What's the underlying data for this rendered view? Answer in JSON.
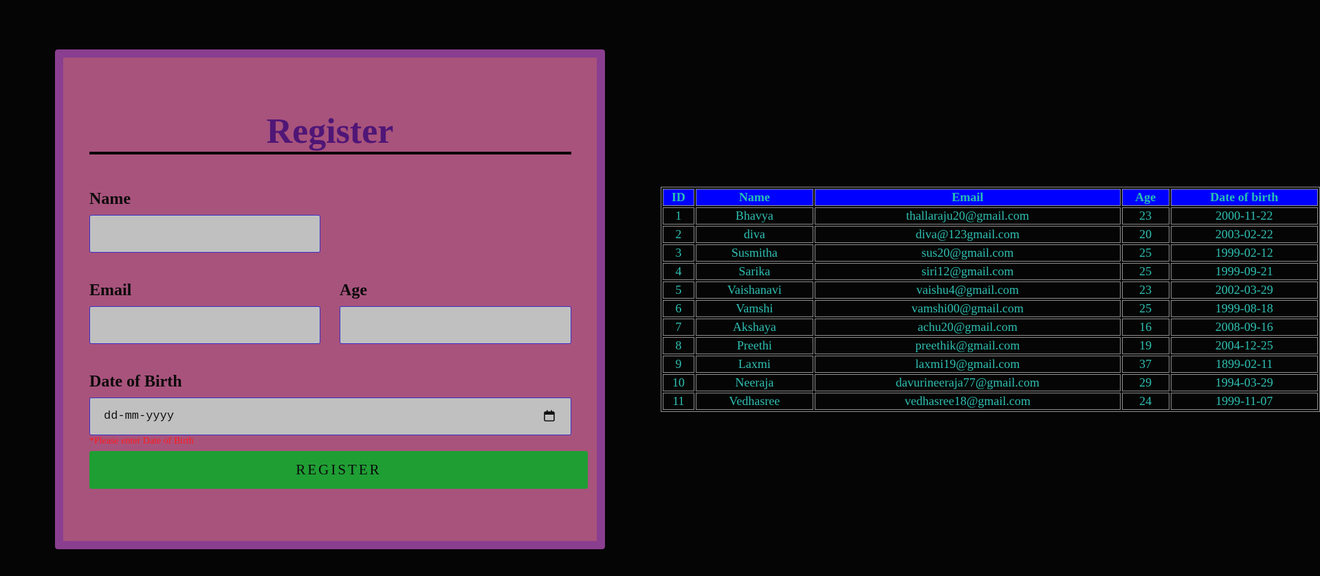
{
  "form": {
    "title": "Register",
    "name_label": "Name",
    "name_value": "",
    "email_label": "Email",
    "email_value": "",
    "age_label": "Age",
    "age_value": "",
    "dob_label": "Date of Birth",
    "dob_placeholder": "dd-mm-yyyy",
    "dob_error": "*Please enter Date of Birth",
    "submit_label": "REGISTER"
  },
  "table": {
    "headers": [
      "ID",
      "Name",
      "Email",
      "Age",
      "Date of birth"
    ],
    "rows": [
      [
        "1",
        "Bhavya",
        "thallaraju20@gmail.com",
        "23",
        "2000-11-22"
      ],
      [
        "2",
        "diva",
        "diva@123gmail.com",
        "20",
        "2003-02-22"
      ],
      [
        "3",
        "Susmitha",
        "sus20@gmail.com",
        "25",
        "1999-02-12"
      ],
      [
        "4",
        "Sarika",
        "siri12@gmail.com",
        "25",
        "1999-09-21"
      ],
      [
        "5",
        "Vaishanavi",
        "vaishu4@gmail.com",
        "23",
        "2002-03-29"
      ],
      [
        "6",
        "Vamshi",
        "vamshi00@gmail.com",
        "25",
        "1999-08-18"
      ],
      [
        "7",
        "Akshaya",
        "achu20@gmail.com",
        "16",
        "2008-09-16"
      ],
      [
        "8",
        "Preethi",
        "preethik@gmail.com",
        "19",
        "2004-12-25"
      ],
      [
        "9",
        "Laxmi",
        "laxmi19@gmail.com",
        "37",
        "1899-02-11"
      ],
      [
        "10",
        "Neeraja",
        "davurineeraja77@gmail.com",
        "29",
        "1994-03-29"
      ],
      [
        "11",
        "Vedhasree",
        "vedhasree18@gmail.com",
        "24",
        "1999-11-07"
      ]
    ]
  },
  "colors": {
    "page_background": "#050505",
    "form_border": "#8a3e8f",
    "form_background": "#a8537c",
    "title_color": "#4f1676",
    "input_background": "#c0c0c0",
    "input_border": "#3b2fc4",
    "error_color": "#ff1a1a",
    "button_background": "#1f9e34",
    "table_header_background": "#0000ff",
    "table_text_color": "#2fbfb2"
  },
  "icons": {
    "date_picker": "calendar-icon"
  }
}
